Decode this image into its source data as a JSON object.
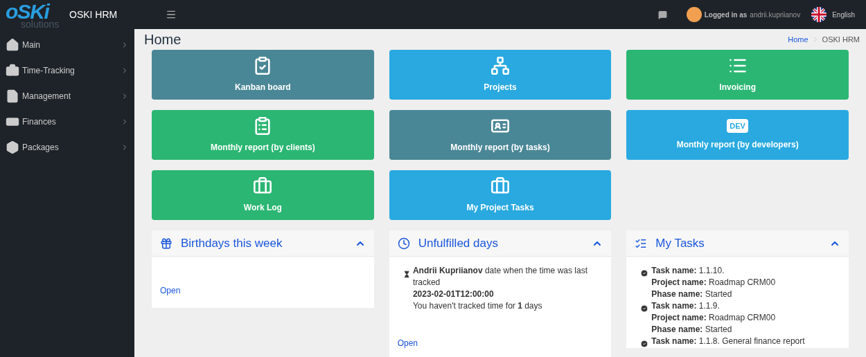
{
  "logo": {
    "mark": "oSKi",
    "sub": "solutions"
  },
  "header": {
    "app_name": "OSKI HRM",
    "user_prefix": "Logged in as",
    "username": "andrii.kupriianov",
    "language": "English"
  },
  "sidebar": {
    "items": [
      {
        "label": "Main",
        "expanded": false
      },
      {
        "label": "Time-Tracking",
        "expanded": false
      },
      {
        "label": "Management",
        "expanded": false
      },
      {
        "label": "Finances",
        "expanded": false
      },
      {
        "label": "Packages",
        "expanded": false
      }
    ]
  },
  "page": {
    "title": "Home",
    "breadcrumbs": [
      {
        "label": "Home",
        "link": true
      },
      {
        "label": "OSKI HRM",
        "link": false
      }
    ]
  },
  "tiles": [
    {
      "label": "Kanban board",
      "color": "#4a8796"
    },
    {
      "label": "Projects",
      "color": "#29a9e0"
    },
    {
      "label": "Invoicing",
      "color": "#2bb673"
    },
    {
      "label": "Monthly report (by clients)",
      "color": "#2bb673"
    },
    {
      "label": "Monthly report (by tasks)",
      "color": "#4a8796"
    },
    {
      "label": "Monthly report (by developers)",
      "color": "#29a9e0",
      "icon_text": "DEV"
    },
    {
      "label": "Work Log",
      "color": "#2bb673"
    },
    {
      "label": "My Project Tasks",
      "color": "#29a9e0"
    }
  ],
  "panels": [
    {
      "kind": "birthdays",
      "title": "Birthdays this week",
      "expanded": true,
      "link": "Open"
    },
    {
      "kind": "unfulfilled",
      "title": "Unfulfilled days",
      "expanded": true,
      "lines": [
        "**Andrii Kupriianov** date when the time was last tracked",
        "**2023-02-01T12:00:00**",
        "You haven't tracked time for **1** days"
      ],
      "link": "Open"
    },
    {
      "kind": "tasks",
      "title": "My Tasks",
      "expanded": true,
      "tasks": [
        {
          "lines": [
            "**Task name:** 1.1.10.",
            "**Project name:** Roadmap CRM00",
            "**Phase name:** Started"
          ]
        },
        {
          "lines": [
            "**Task name:** 1.1.9.",
            "**Project name:** Roadmap CRM00",
            "**Phase name:** Started"
          ]
        },
        {
          "lines": [
            "**Task name:** 1.1.8. General finance report"
          ]
        }
      ]
    }
  ]
}
